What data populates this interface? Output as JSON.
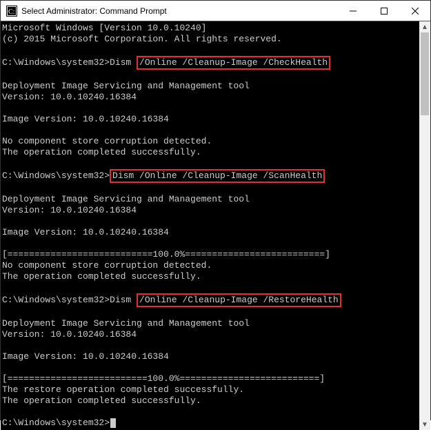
{
  "window": {
    "title": "Select Administrator: Command Prompt"
  },
  "term": {
    "header1": "Microsoft Windows [Version 10.0.10240]",
    "header2": "(c) 2015 Microsoft Corporation. All rights reserved.",
    "prompt": "C:\\Windows\\system32>",
    "dism": "Dism ",
    "cmd1_hl": "/Online /Cleanup-Image /CheckHealth",
    "cmd2_hl": "Dism /Online /Cleanup-Image /ScanHealth",
    "cmd3_hl": "/Online /Cleanup-Image /RestoreHealth",
    "tool_line": "Deployment Image Servicing and Management tool",
    "ver_line": "Version: 10.0.10240.16384",
    "img_ver": "Image Version: 10.0.10240.16384",
    "no_corrupt": "No component store corruption detected.",
    "op_success": "The operation completed successfully.",
    "progress": "[===========================100.0%==========================]",
    "progress2": "[==========================100.0%==========================] ",
    "restore_success": "The restore operation completed successfully."
  }
}
